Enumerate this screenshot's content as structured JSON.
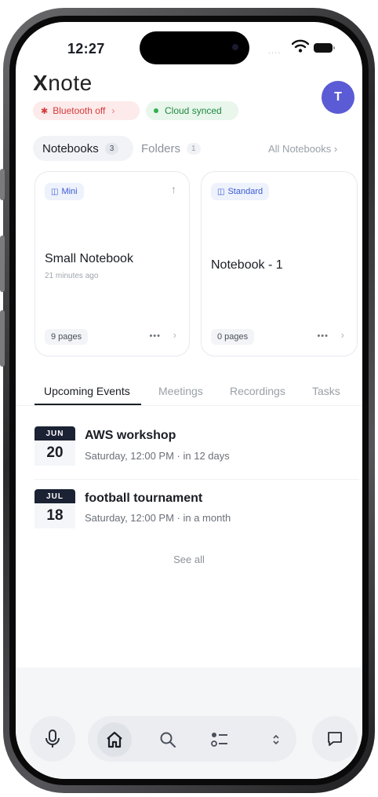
{
  "status_bar": {
    "time": "12:27",
    "signal": "....",
    "wifi_icon": "wifi-icon",
    "battery_icon": "battery-icon"
  },
  "header": {
    "logo_x": "X",
    "logo_rest": "note",
    "avatar_initial": "T"
  },
  "status_pills": {
    "bluetooth": {
      "label": "Bluetooth off",
      "chevron": "›",
      "icon": "bluetooth-off-icon",
      "color": "#d33b3b"
    },
    "cloud": {
      "label": "Cloud synced",
      "icon": "green-dot",
      "color": "#1e8a3e"
    }
  },
  "segments": {
    "notebooks": {
      "label": "Notebooks",
      "count": "3"
    },
    "folders": {
      "label": "Folders",
      "count": "1"
    },
    "all_link": "All Notebooks ›"
  },
  "notebooks": [
    {
      "tag": "Mini",
      "title": "Small Notebook",
      "subtitle": "21 minutes ago",
      "pages": "9 pages",
      "more": "•••",
      "chevron": "›",
      "upload": "↑"
    },
    {
      "tag": "Standard",
      "title": "Notebook - 1",
      "subtitle": "",
      "pages": "0 pages",
      "more": "•••",
      "chevron": "›"
    }
  ],
  "tabs": [
    {
      "label": "Upcoming Events",
      "active": true
    },
    {
      "label": "Meetings",
      "active": false
    },
    {
      "label": "Recordings",
      "active": false
    },
    {
      "label": "Tasks",
      "active": false
    }
  ],
  "events": [
    {
      "month": "JUN",
      "day": "20",
      "title": "AWS workshop",
      "subtitle": "Saturday, 12:00 PM · in 12 days"
    },
    {
      "month": "JUL",
      "day": "18",
      "title": "football tournament",
      "subtitle": "Saturday, 12:00 PM · in a month"
    }
  ],
  "see_all": "See all",
  "bottom_nav": [
    {
      "icon": "microphone-icon"
    },
    {
      "icon": "home-icon",
      "active": true
    },
    {
      "icon": "search-icon"
    },
    {
      "icon": "list-icon"
    },
    {
      "icon": "chevron-up-down-icon"
    },
    {
      "icon": "chat-icon"
    }
  ],
  "colors": {
    "accent": "#5b5bd6",
    "tag_blue": "#3b5bd6",
    "danger": "#d33b3b",
    "success": "#2fb14e"
  }
}
